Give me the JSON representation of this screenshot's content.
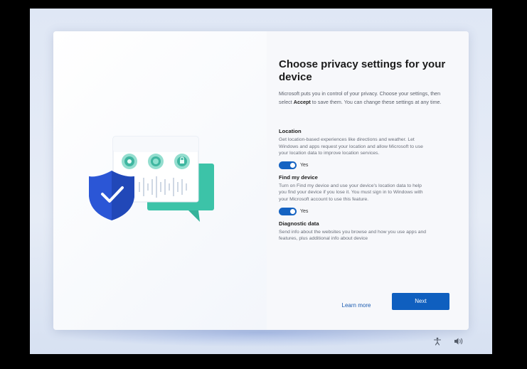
{
  "dialog": {
    "title": "Choose privacy settings for your device",
    "intro_before": "Microsoft puts you in control of your privacy. Choose your settings, then select ",
    "intro_bold": "Accept",
    "intro_after": " to save them. You can change these settings at any time.",
    "sections": [
      {
        "title": "Location",
        "description": "Get location-based experiences like directions and weather. Let Windows and apps request your location and allow Microsoft to use your location data to improve location services.",
        "toggle_label": "Yes",
        "toggle_on": true
      },
      {
        "title": "Find my device",
        "description": "Turn on Find my device and use your device's location data to help you find your device if you lose it. You must sign in to Windows with your Microsoft account to use this feature.",
        "toggle_label": "Yes",
        "toggle_on": true
      },
      {
        "title": "Diagnostic data",
        "description": "Send info about the websites you browse and how you use apps and features, plus additional info about device"
      }
    ],
    "learn_more_label": "Learn more",
    "next_label": "Next"
  },
  "tray": {
    "icons": [
      "accessibility-icon",
      "volume-icon"
    ]
  },
  "colors": {
    "accent": "#0f5fbf",
    "shield": "#2b56d6",
    "chat_bubble": "#3cc3a8"
  }
}
